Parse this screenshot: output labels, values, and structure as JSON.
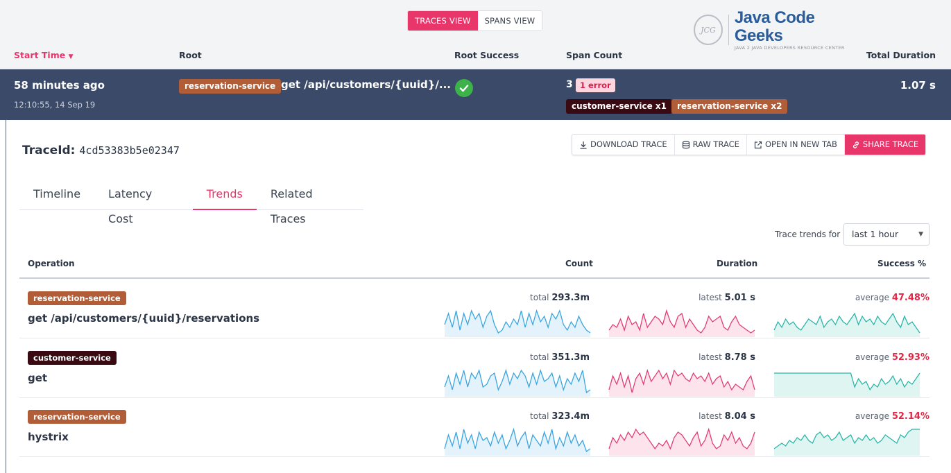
{
  "view_toggle": {
    "traces": "TRACES VIEW",
    "spans": "SPANS VIEW"
  },
  "logo": {
    "mark": "JCG",
    "name": "Java Code Geeks",
    "tagline": "JAVA 2 JAVA DEVELOPERS RESOURCE CENTER"
  },
  "columns": {
    "start": "Start Time",
    "root": "Root",
    "success": "Root Success",
    "span_count": "Span Count",
    "total": "Total Duration"
  },
  "trace": {
    "ago": "58 minutes ago",
    "timestamp": "12:10:55, 14 Sep 19",
    "root_service": "reservation-service",
    "root_op": "get /api/customers/{uuid}/...",
    "span_count": "3",
    "errors": "1 error",
    "services": [
      "customer-service x1",
      "reservation-service x2"
    ],
    "total": "1.07 s"
  },
  "details": {
    "traceid_label": "TraceId:",
    "traceid": "4cd53383b5e02347",
    "actions": {
      "download": "DOWNLOAD TRACE",
      "raw": "RAW TRACE",
      "open": "OPEN IN NEW TAB",
      "share": "SHARE TRACE"
    },
    "tabs": [
      "Timeline",
      "Latency Cost",
      "Trends",
      "Related Traces"
    ],
    "trends_for": "Trace trends for",
    "range": "last 1 hour"
  },
  "table": {
    "headers": {
      "op": "Operation",
      "count": "Count",
      "duration": "Duration",
      "success": "Success %"
    },
    "rows": [
      {
        "service": "reservation-service",
        "op": "get /api/customers/{uuid}/reservations",
        "count_label": "total",
        "count": "293.3m",
        "dur_label": "latest",
        "duration": "5.01 s",
        "succ_label": "average",
        "success": "47.48%"
      },
      {
        "service": "customer-service",
        "op": "get",
        "count_label": "total",
        "count": "351.3m",
        "dur_label": "latest",
        "duration": "8.78 s",
        "succ_label": "average",
        "success": "52.93%"
      },
      {
        "service": "reservation-service",
        "op": "hystrix",
        "count_label": "total",
        "count": "323.4m",
        "dur_label": "latest",
        "duration": "8.04 s",
        "succ_label": "average",
        "success": "52.14%"
      }
    ]
  },
  "colors": {
    "accent": "#e8366b",
    "reservation": "#b15d38",
    "customer": "#3a0a12",
    "count_line": "#3aa5e0",
    "dur_line": "#e23c73",
    "succ_line": "#2ab5a8"
  },
  "sparklines": {
    "count": [
      [
        4,
        8,
        3,
        9,
        2,
        8,
        4,
        9,
        6,
        8,
        3,
        7,
        9,
        4,
        1,
        2,
        5,
        3,
        6,
        4,
        9,
        3,
        8,
        4,
        9,
        5,
        7,
        3,
        8,
        6,
        9,
        4,
        2,
        5,
        3,
        7,
        4,
        2,
        1
      ],
      [
        3,
        7,
        2,
        8,
        4,
        9,
        3,
        8,
        6,
        9,
        3,
        4,
        7,
        8,
        2,
        5,
        9,
        4,
        8,
        6,
        9,
        7,
        3,
        8,
        4,
        9,
        5,
        6,
        8,
        3,
        7,
        2,
        6,
        4,
        8,
        5,
        9,
        1,
        2
      ],
      [
        2,
        7,
        3,
        8,
        2,
        9,
        4,
        7,
        2,
        8,
        5,
        6,
        3,
        8,
        4,
        7,
        2,
        5,
        9,
        3,
        6,
        8,
        2,
        7,
        5,
        3,
        8,
        4,
        9,
        2,
        6,
        3,
        8,
        4,
        7,
        3,
        5,
        1,
        2
      ]
    ],
    "duration": [
      [
        2,
        4,
        3,
        6,
        2,
        7,
        4,
        5,
        2,
        8,
        3,
        5,
        7,
        6,
        4,
        9,
        5,
        3,
        7,
        8,
        3,
        6,
        4,
        2,
        1,
        3,
        7,
        5,
        6,
        7,
        3,
        2,
        5,
        7,
        4,
        3,
        2,
        1,
        2
      ],
      [
        2,
        7,
        4,
        8,
        3,
        7,
        1,
        6,
        8,
        4,
        9,
        5,
        7,
        9,
        6,
        8,
        4,
        9,
        7,
        8,
        6,
        5,
        8,
        6,
        7,
        5,
        8,
        4,
        6,
        7,
        3,
        5,
        2,
        4,
        3,
        2,
        5,
        7,
        2
      ],
      [
        2,
        6,
        4,
        7,
        5,
        8,
        6,
        9,
        7,
        8,
        6,
        4,
        2,
        4,
        3,
        5,
        2,
        6,
        8,
        7,
        5,
        3,
        6,
        8,
        3,
        5,
        9,
        4,
        2,
        3,
        7,
        5,
        8,
        4,
        6,
        3,
        2,
        4,
        8
      ]
    ],
    "success": [
      [
        2,
        5,
        3,
        6,
        4,
        5,
        3,
        2,
        4,
        6,
        5,
        4,
        7,
        3,
        5,
        6,
        4,
        7,
        5,
        4,
        6,
        8,
        4,
        7,
        5,
        6,
        4,
        7,
        5,
        4,
        6,
        8,
        5,
        3,
        7,
        4,
        5,
        3,
        1
      ],
      [
        8,
        8,
        8,
        8,
        8,
        8,
        8,
        8,
        8,
        8,
        8,
        8,
        8,
        8,
        8,
        8,
        8,
        8,
        8,
        8,
        8,
        3,
        6,
        4,
        5,
        2,
        4,
        3,
        6,
        4,
        5,
        7,
        4,
        6,
        3,
        5,
        4,
        6,
        8
      ],
      [
        2,
        3,
        4,
        3,
        5,
        4,
        6,
        5,
        7,
        5,
        4,
        7,
        8,
        6,
        7,
        5,
        6,
        8,
        5,
        6,
        7,
        4,
        6,
        5,
        7,
        5,
        6,
        4,
        5,
        7,
        6,
        5,
        4,
        7,
        6,
        8,
        9,
        9,
        9
      ]
    ]
  }
}
